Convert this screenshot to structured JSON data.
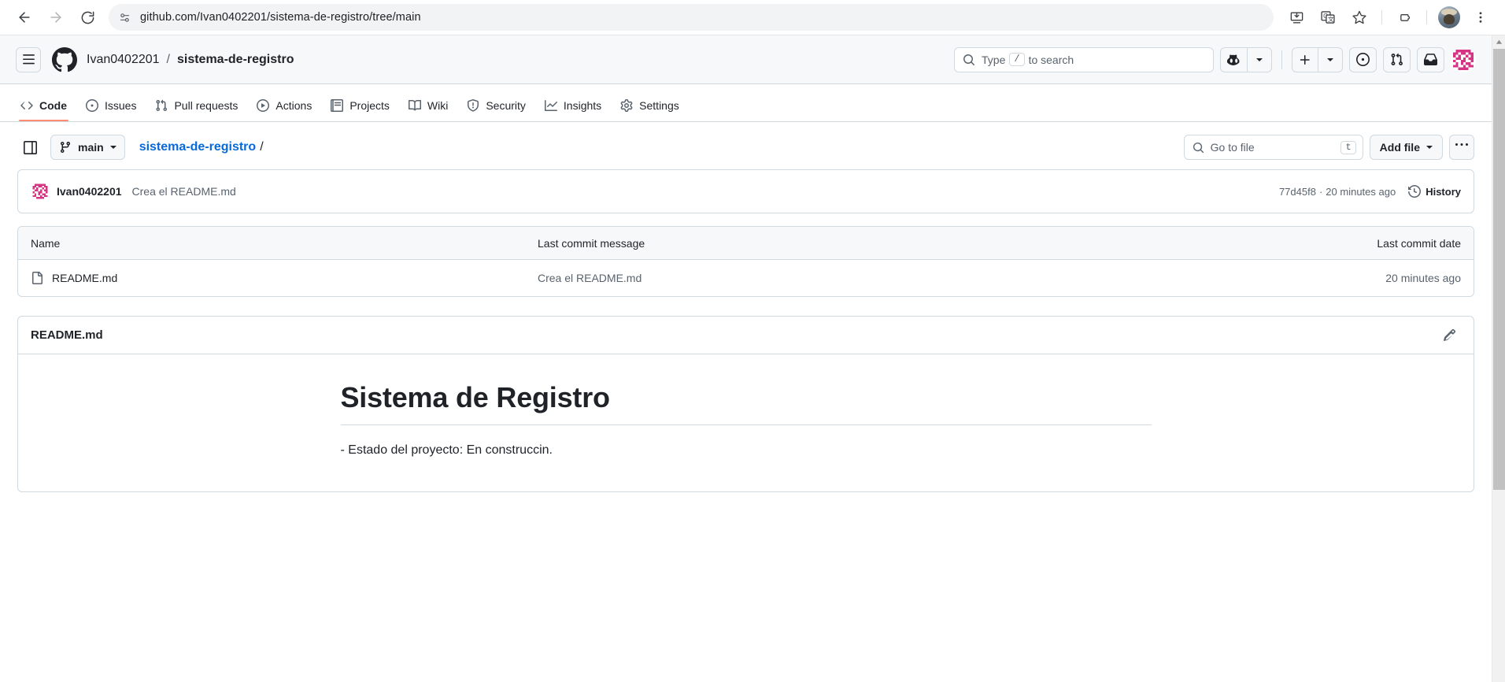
{
  "browser": {
    "url": "github.com/Ivan0402201/sistema-de-registro/tree/main",
    "back_label": "Back",
    "forward_label": "Forward",
    "reload_label": "Reload",
    "site_info_label": "View site information",
    "install_label": "Install",
    "translate_label": "Translate this page",
    "bookmark_label": "Bookmark this tab",
    "extensions_label": "Extensions",
    "profile_label": "Profile",
    "menu_label": "Customize and control Chrome"
  },
  "gh_header": {
    "menu_label": "Open global navigation menu",
    "logo_label": "Homepage",
    "owner": "Ivan0402201",
    "separator": "/",
    "repo": "sistema-de-registro",
    "search_placeholder_before": "Type",
    "search_kbd": "/",
    "search_placeholder_after": "to search",
    "copilot_label": "Copilot",
    "copilot_caret_label": "Copilot menu",
    "create_label": "Create new...",
    "create_caret_label": "Create new menu",
    "issues_label": "Your issues",
    "pulls_label": "Your pull requests",
    "inbox_label": "Notifications",
    "avatar_label": "Open user account menu"
  },
  "repo_nav": {
    "tabs": [
      {
        "label": "Code",
        "icon": "code-icon",
        "active": true
      },
      {
        "label": "Issues",
        "icon": "issue-icon",
        "active": false
      },
      {
        "label": "Pull requests",
        "icon": "pr-icon",
        "active": false
      },
      {
        "label": "Actions",
        "icon": "play-icon",
        "active": false
      },
      {
        "label": "Projects",
        "icon": "table-icon",
        "active": false
      },
      {
        "label": "Wiki",
        "icon": "book-icon",
        "active": false
      },
      {
        "label": "Security",
        "icon": "shield-icon",
        "active": false
      },
      {
        "label": "Insights",
        "icon": "graph-icon",
        "active": false
      },
      {
        "label": "Settings",
        "icon": "gear-icon",
        "active": false
      }
    ]
  },
  "file_toolbar": {
    "sidebar_toggle_label": "Expand file tree",
    "branch": "main",
    "branch_picker_label": "main branch",
    "path_repo": "sistema-de-registro",
    "path_slash": "/",
    "gotofile_placeholder": "Go to file",
    "gotofile_kbd": "t",
    "add_file_label": "Add file",
    "more_label": "More options"
  },
  "commit": {
    "author": "Ivan0402201",
    "message": "Crea el README.md",
    "hash": "77d45f8",
    "separator": "·",
    "relative_time": "20 minutes ago",
    "history_label": "History"
  },
  "file_table": {
    "headers": {
      "name": "Name",
      "message": "Last commit message",
      "date": "Last commit date"
    },
    "rows": [
      {
        "icon": "file-icon",
        "name": "README.md",
        "message": "Crea el README.md",
        "date": "20 minutes ago"
      }
    ]
  },
  "readme": {
    "title": "README.md",
    "edit_label": "Edit README",
    "heading": "Sistema de Registro",
    "paragraph": "- Estado del proyecto: En construccin."
  },
  "colors": {
    "accent": "#0969da",
    "active_tab_underline": "#fd8c73",
    "border": "#d1d9e0",
    "canvas_subtle": "#f6f8fa",
    "text_muted": "#59636e",
    "avatar_pink": "#d63384"
  }
}
